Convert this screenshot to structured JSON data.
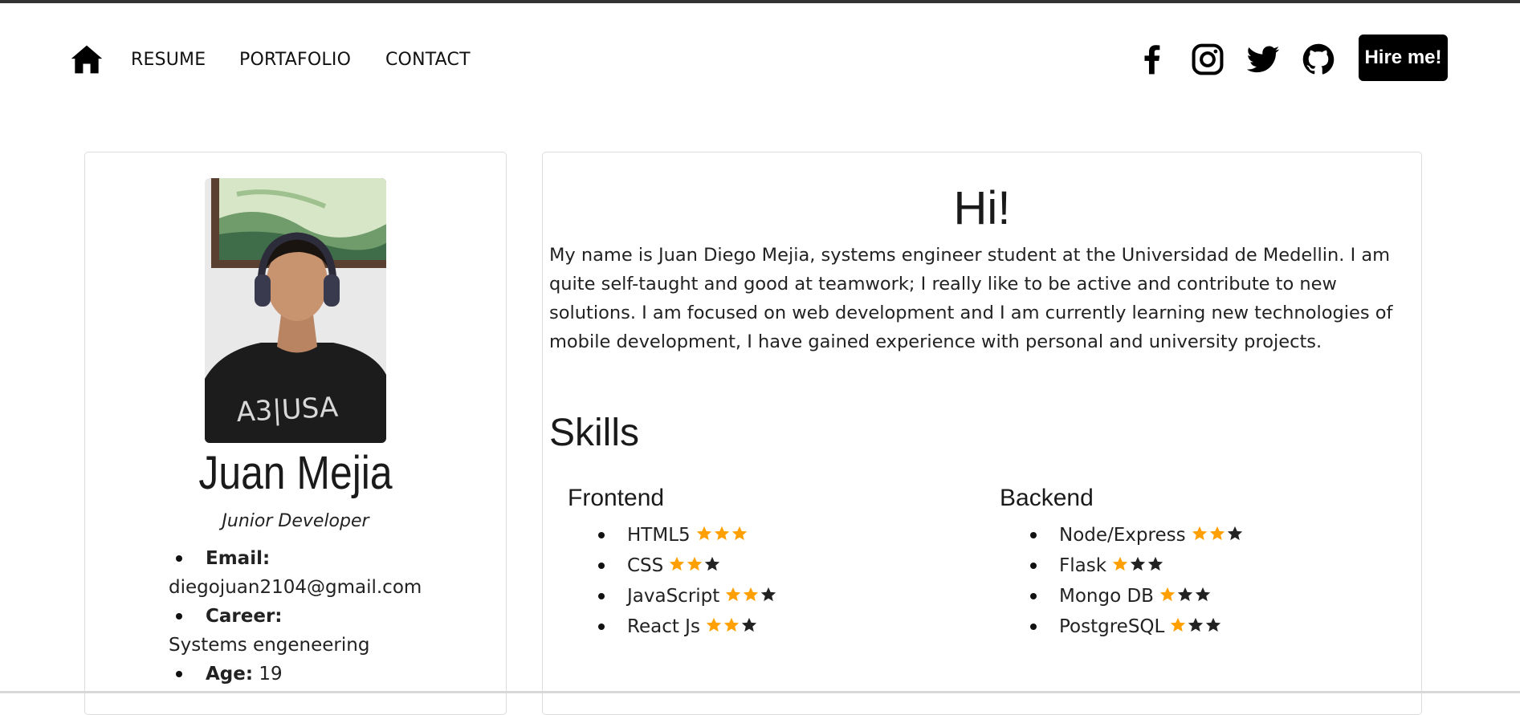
{
  "nav": {
    "home_icon": "home-icon",
    "links": [
      "RESUME",
      "PORTAFOLIO",
      "CONTACT"
    ],
    "social_icons": [
      "facebook-icon",
      "instagram-icon",
      "twitter-icon",
      "github-icon"
    ],
    "hire_label": "Hire me!"
  },
  "profile": {
    "name": "Juan Mejia",
    "role": "Junior Developer",
    "info": [
      {
        "label": "Email:",
        "value": "diegojuan2104@gmail.com"
      },
      {
        "label": "Career:",
        "value": "Systems engeneering"
      },
      {
        "label": "Age:",
        "value": "19"
      }
    ]
  },
  "about": {
    "greeting": "Hi!",
    "bio": "My name is Juan Diego Mejia, systems engineer student at the Universidad de Medellin. I am quite self-taught and good at teamwork; I really like to be active and contribute to new solutions. I am focused on web development and I am currently learning new technologies of mobile development, I have gained experience with personal and university projects.",
    "skills_title": "Skills",
    "frontend": {
      "title": "Frontend",
      "items": [
        {
          "name": "HTML5",
          "rating": 3,
          "max": 3
        },
        {
          "name": "CSS",
          "rating": 2,
          "max": 3
        },
        {
          "name": "JavaScript",
          "rating": 2,
          "max": 3
        },
        {
          "name": "React Js",
          "rating": 2,
          "max": 3
        }
      ]
    },
    "backend": {
      "title": "Backend",
      "items": [
        {
          "name": "Node/Express",
          "rating": 2,
          "max": 3
        },
        {
          "name": "Flask",
          "rating": 1,
          "max": 3
        },
        {
          "name": "Mongo DB",
          "rating": 1,
          "max": 3
        },
        {
          "name": "PostgreSQL",
          "rating": 1,
          "max": 3
        }
      ]
    }
  },
  "colors": {
    "star_filled": "#ffa000",
    "star_empty": "#222222",
    "button_bg": "#000000"
  }
}
